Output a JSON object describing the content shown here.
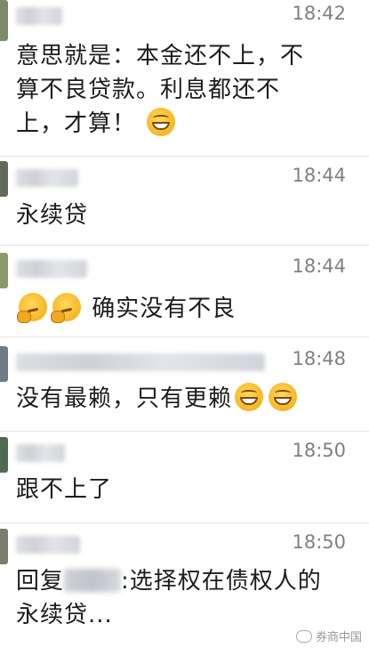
{
  "messages": [
    {
      "time": "18:42",
      "lines": [
        "意思就是：本金还不上，不",
        "算不良贷款。利息都还不",
        "上，才算！"
      ],
      "trailing_emoji": [
        "grin-emoji"
      ]
    },
    {
      "time": "18:44",
      "lines": [
        "永续贷"
      ],
      "trailing_emoji": []
    },
    {
      "time": "18:44",
      "leading_emoji": [
        "thinking-emoji",
        "thinking-emoji"
      ],
      "lines": [
        "确实没有不良"
      ]
    },
    {
      "time": "18:48",
      "lines": [
        "没有最赖，只有更赖"
      ],
      "trailing_emoji": [
        "grin-emoji",
        "grin-emoji"
      ]
    },
    {
      "time": "18:50",
      "lines": [
        "跟不上了"
      ],
      "trailing_emoji": []
    },
    {
      "time": "18:50",
      "reply_prefix": "回复",
      "reply_text": ":选择权在债权人的",
      "lines_after": [
        "永续贷..."
      ]
    }
  ],
  "watermark": {
    "text": "券商中国"
  },
  "colors": {
    "time": "#808080",
    "text": "#1c1c1c",
    "divider": "#e5e5e5"
  }
}
